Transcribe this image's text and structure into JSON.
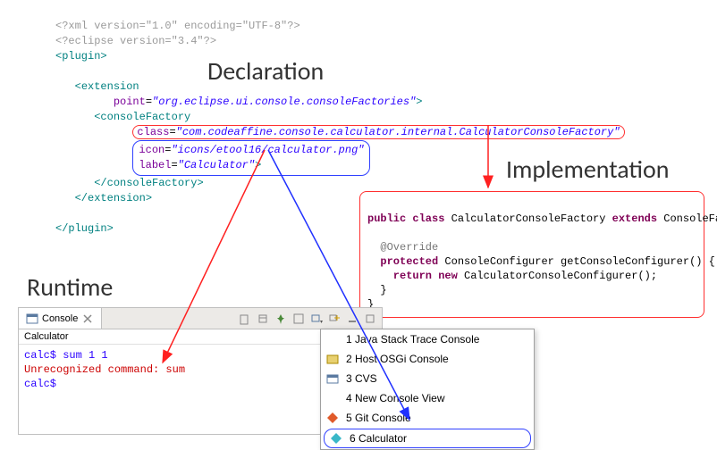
{
  "xml": {
    "line1": "<?xml version=\"1.0\" encoding=\"UTF-8\"?>",
    "line2": "<?eclipse version=\"3.4\"?>",
    "plugin_open": "plugin",
    "extension_open": "extension",
    "point_attr": "point",
    "point_val": "\"org.eclipse.ui.console.consoleFactories\"",
    "cf_open": "consoleFactory",
    "class_attr": "class",
    "class_val": "\"com.codeaffine.console.calculator.internal.CalculatorConsoleFactory\"",
    "icon_attr": "icon",
    "icon_val": "\"icons/etool16/calculator.png\"",
    "label_attr": "label",
    "label_val": "\"Calculator\"",
    "cf_close": "consoleFactory",
    "extension_close": "extension",
    "plugin_close": "plugin"
  },
  "annotations": {
    "declaration": "Declaration",
    "implementation": "Implementation",
    "runtime": "Runtime"
  },
  "impl": {
    "l1a": "public class ",
    "l1b": "CalculatorConsoleFactory ",
    "l1c": "extends ",
    "l1d": "ConsoleFactory {",
    "l2": "  ",
    "l3": "  @Override",
    "l4a": "  protected ",
    "l4b": "ConsoleConfigurer getConsoleConfigurer() {",
    "l5a": "    return new ",
    "l5b": "CalculatorConsoleConfigurer();",
    "l6": "  }",
    "l7": "}"
  },
  "console": {
    "tab": "Console",
    "title": "Calculator",
    "line1_prompt": "calc$ ",
    "line1_cmd": "sum 1 1",
    "line2": "Unrecognized command: sum",
    "line3_prompt": "calc$ "
  },
  "menu": {
    "items": [
      "1 Java Stack Trace Console",
      "2 Host OSGi Console",
      "3 CVS",
      "4 New Console View",
      "5 Git Console",
      "6 Calculator"
    ]
  }
}
